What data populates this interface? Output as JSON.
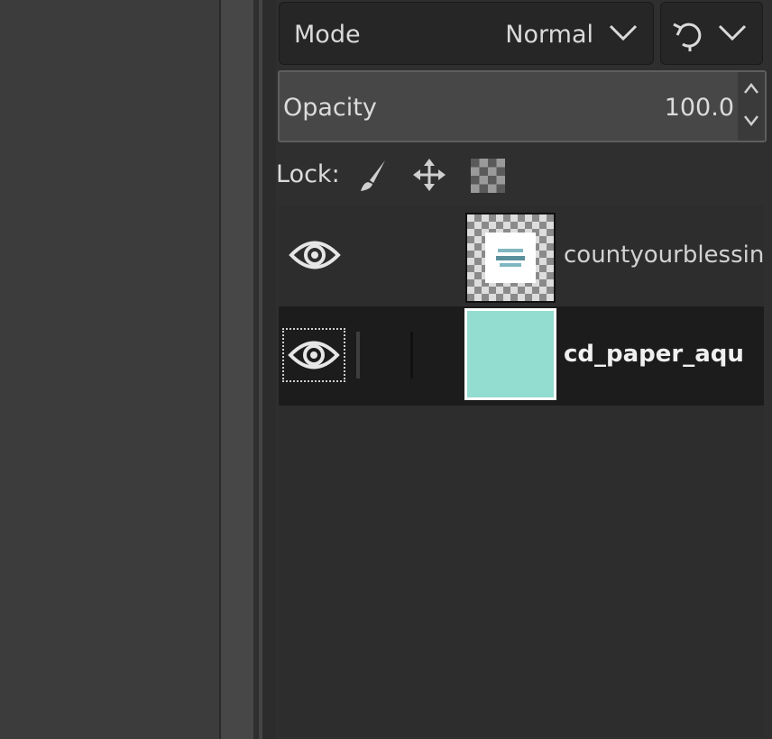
{
  "mode": {
    "label": "Mode",
    "value": "Normal"
  },
  "composite": {
    "icon": "composite-mode-icon"
  },
  "opacity": {
    "label": "Opacity",
    "value": "100.0"
  },
  "lock": {
    "label": "Lock:",
    "icons": [
      "paintbrush-icon",
      "move-icon",
      "alpha-checker-icon"
    ]
  },
  "layers": [
    {
      "name": "countyourblessin",
      "visible": true,
      "selected": false,
      "thumbnail": "transparent-text-layer"
    },
    {
      "name": "cd_paper_aqu",
      "visible": true,
      "selected": true,
      "thumbnail": "aqua-paper"
    }
  ],
  "colors": {
    "panel_bg": "#2f2f2f",
    "selected_row": "#1c1c1c",
    "aqua": "#93dcd0"
  }
}
